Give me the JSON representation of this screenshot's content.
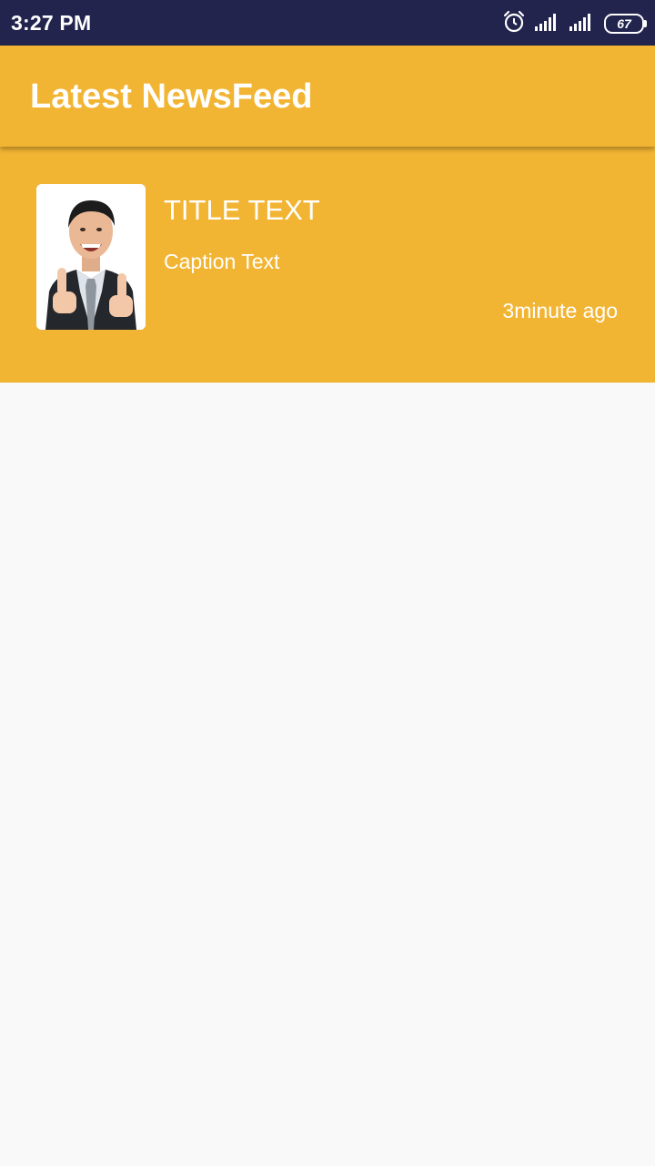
{
  "status_bar": {
    "time": "3:27 PM",
    "battery_level": "67",
    "icons": [
      "alarm-icon",
      "signal-icon",
      "signal-icon",
      "battery-icon"
    ]
  },
  "app_bar": {
    "title": "Latest NewsFeed"
  },
  "feed": {
    "items": [
      {
        "title": "TITLE TEXT",
        "caption": "Caption Text",
        "time": "3minute ago",
        "image": "man-thumbs-up-photo"
      }
    ]
  },
  "colors": {
    "status_bar_bg": "#22244e",
    "accent": "#f2b533",
    "background": "#f9f9f9",
    "text_on_accent": "#ffffff"
  }
}
